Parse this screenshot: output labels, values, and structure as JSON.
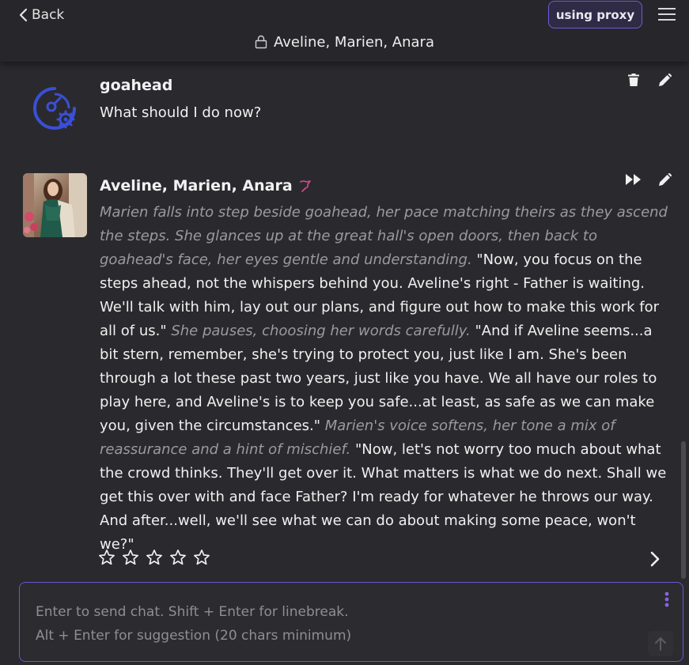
{
  "header": {
    "back_label": "Back",
    "proxy_label": "using proxy",
    "title": "Aveline, Marien, Anara"
  },
  "messages": [
    {
      "author": "goahead",
      "text": "What should I do now?"
    },
    {
      "author": "Aveline, Marien, Anara",
      "segments": [
        {
          "style": "italic",
          "text": "Marien falls into step beside goahead, her pace matching theirs as they ascend the steps. She glances up at the great hall's open doors, then back to goahead's face, her eyes gentle and understanding."
        },
        {
          "style": "normal",
          "text": " \"Now, you focus on the steps ahead, not the whispers behind you. Aveline's right - Father is waiting. We'll talk with him, lay out our plans, and figure out how to make this work for all of us.\" "
        },
        {
          "style": "italic",
          "text": "She pauses, choosing her words carefully."
        },
        {
          "style": "normal",
          "text": " \"And if Aveline seems...a bit stern, remember, she's trying to protect you, just like I am. She's been through a lot these past two years, just like you have. We all have our roles to play here, and Aveline's is to keep you safe...at least, as safe as we can make you, given the circumstances.\" "
        },
        {
          "style": "italic",
          "text": "Marien's voice softens, her tone a mix of reassurance and a hint of mischief."
        },
        {
          "style": "normal",
          "text": " \"Now, let's not worry too much about what the crowd thinks. They'll get over it. What matters is what we do next. Shall we get this over with and face Father? I'm ready for whatever he throws our way. And after...well, we'll see what we can do about making some peace, won't we?\""
        }
      ],
      "rating": {
        "max": 5,
        "value": 0
      }
    }
  ],
  "input": {
    "placeholder": "Enter to send chat. Shift + Enter for linebreak.\nAlt + Enter for suggestion (20 chars minimum)"
  },
  "colors": {
    "accent": "#6e55c9",
    "background": "#2a2a2e",
    "header": "#27272b",
    "italic_text": "#9a9a9f",
    "bot_icon": "#3a4fd8",
    "pin_icon": "#e0469a"
  },
  "icons": [
    "chevron-left-icon",
    "menu-icon",
    "lock-icon",
    "bot-gear-icon",
    "trash-icon",
    "pencil-icon",
    "fast-forward-icon",
    "pin-icon",
    "star-icon",
    "chevron-right-icon",
    "kebab-icon",
    "arrow-up-icon"
  ]
}
